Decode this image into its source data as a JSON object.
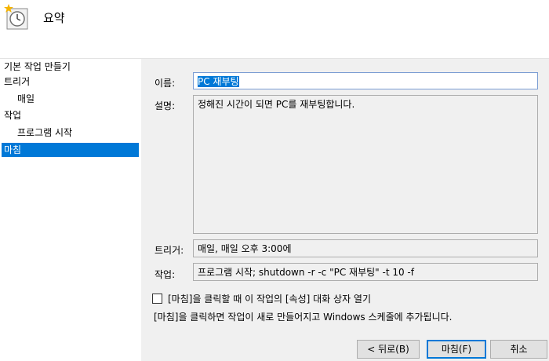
{
  "header": {
    "title": "요약",
    "icon": "task-clock-icon"
  },
  "nav": {
    "items": [
      {
        "label": "기본 작업 만들기",
        "sub": false,
        "active": false
      },
      {
        "label": "트리거",
        "sub": false,
        "active": false
      },
      {
        "label": "매일",
        "sub": true,
        "active": false
      },
      {
        "label": "작업",
        "sub": false,
        "active": false
      },
      {
        "label": "프로그램 시작",
        "sub": true,
        "active": false
      },
      {
        "label": "마침",
        "sub": false,
        "active": true
      }
    ]
  },
  "form": {
    "name_label": "이름:",
    "name_value": "PC 재부팅",
    "desc_label": "설명:",
    "desc_value": "정해진 시간이 되면 PC를 재부팅합니다.",
    "trigger_label": "트리거:",
    "trigger_value": "매일, 매일 오후 3:00에",
    "action_label": "작업:",
    "action_value": "프로그램 시작; shutdown -r -c \"PC 재부팅\" -t 10 -f"
  },
  "options": {
    "open_props_label": "[마침]을 클릭할 때 이 작업의 [속성] 대화 상자 열기",
    "open_props_checked": false,
    "finish_note": "[마침]을 클릭하면 작업이 새로 만들어지고 Windows 스케줄에 추가됩니다."
  },
  "buttons": {
    "back": "< 뒤로(B)",
    "finish": "마침(F)",
    "cancel": "취소"
  },
  "colors": {
    "accent": "#0078d7",
    "header_bg": "#ffffff",
    "body_bg": "#f0f0f0"
  }
}
